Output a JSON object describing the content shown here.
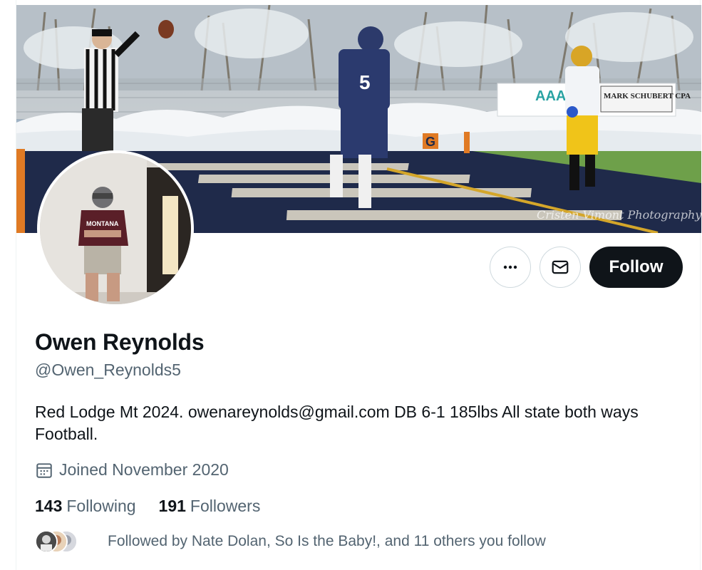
{
  "profile": {
    "display_name": "Owen Reynolds",
    "handle": "@Owen_Reynolds5",
    "bio": "Red Lodge Mt 2024. owenareynolds@gmail.com DB 6-1 185lbs All state both ways Football.",
    "joined": "Joined November 2020",
    "following_count": "143",
    "following_label": "Following",
    "followers_count": "191",
    "followers_label": "Followers",
    "followed_by": "Followed by Nate Dolan, So Is the Baby!, and 11 others you follow"
  },
  "actions": {
    "more_icon": "more-horizontal-icon",
    "message_icon": "envelope-icon",
    "follow_label": "Follow"
  },
  "banner": {
    "sign_text": "MARK SCHUBERT CPA",
    "end_zone_letter": "G",
    "jersey_number": "5",
    "watermark": "Cristen Vimont Photography"
  },
  "avatar": {
    "jersey_text": "MONTANA"
  },
  "colors": {
    "follow_button_bg": "#0f1419",
    "secondary_text": "#536471",
    "border": "#cfd9de"
  }
}
